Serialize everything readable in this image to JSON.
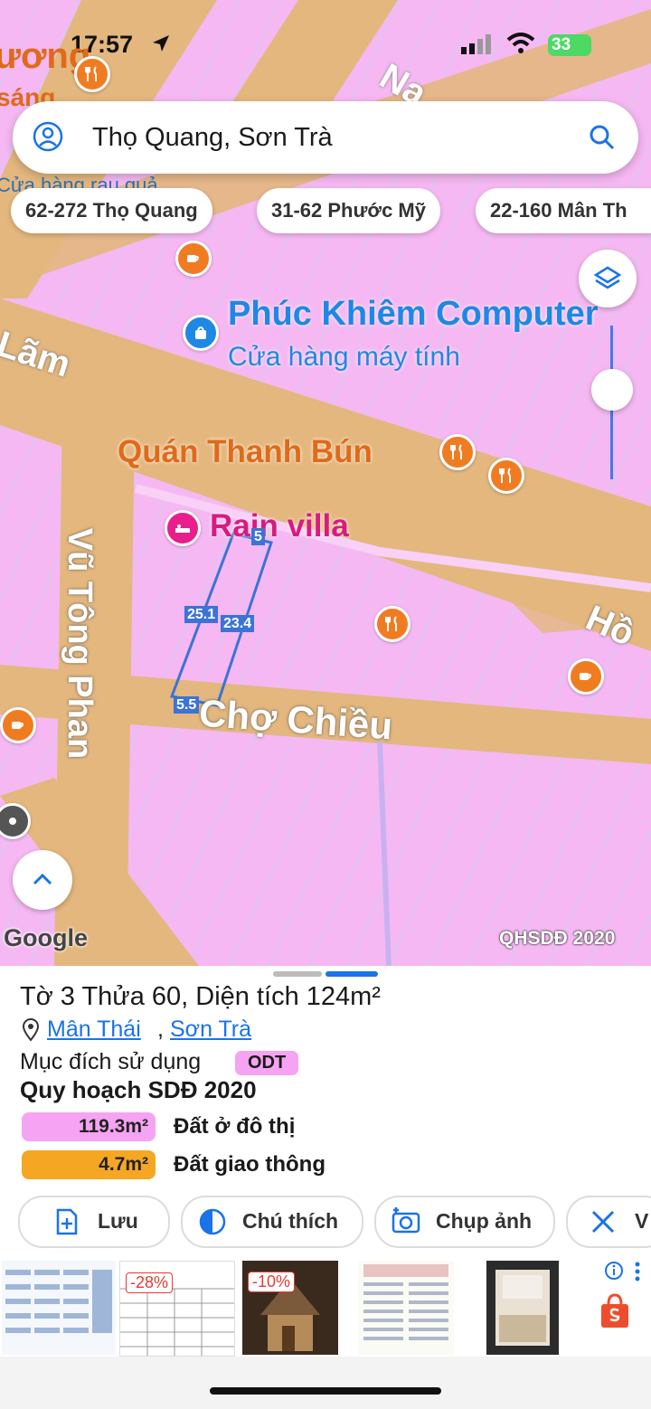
{
  "status_bar": {
    "time": "17:57",
    "battery": "33"
  },
  "search": {
    "query": "Thọ Quang, Sơn Trà",
    "icons": [
      "user-icon",
      "search-icon"
    ]
  },
  "chips": [
    "62-272 Thọ Quang",
    "31-62 Phước Mỹ",
    "22-160 Mân Th"
  ],
  "map_labels": {
    "top_left_1": "ương",
    "top_left_2": "sáng",
    "top_left_3": "Cửa hàng rau quả",
    "road_top_right": "Na",
    "road_lam": "Lãm",
    "poi_phuc_khiem_name": "Phúc Khiêm Computer",
    "poi_phuc_khiem_type": "Cửa hàng máy tính",
    "poi_quan_thanh_bun": "Quán Thanh Bún",
    "poi_rain_villa": "Rain villa",
    "road_vu_tong_phan": "Vũ Tông Phan",
    "road_cho_chieu": "Chợ Chiều",
    "road_ho": "Hồ",
    "google": "Google",
    "layer_name": "QHSDĐ 2020"
  },
  "parcel_measurements": [
    "5",
    "25.1",
    "23.4",
    "5.5"
  ],
  "parcel": {
    "title": "Tờ 3 Thửa 60, Diện tích 124m²",
    "ward_link": "Mân Thái",
    "district_link": "Sơn Trà",
    "separator": ",",
    "purpose_label": "Mục đích sử dụng",
    "purpose_code": "ODT",
    "plan_title": "Quy hoạch SDĐ 2020",
    "land_uses": [
      {
        "area": "119.3m²",
        "label": "Đất ở đô thị",
        "color": "#f5a3f2"
      },
      {
        "area": "4.7m²",
        "label": "Đất giao thông",
        "color": "#f5a623"
      }
    ]
  },
  "actions": [
    "Lưu",
    "Chú thích",
    "Chụp ảnh",
    "V"
  ],
  "ads": {
    "badges": [
      "-28%",
      "-10%"
    ],
    "icons": [
      "info-icon",
      "more-icon",
      "shopee-bag-icon"
    ]
  },
  "colors": {
    "accent": "#1a73e8",
    "residential": "#f5a3f2",
    "road": "#e3b77e",
    "poi": "#f07c22",
    "measure": "#3b73d6"
  }
}
